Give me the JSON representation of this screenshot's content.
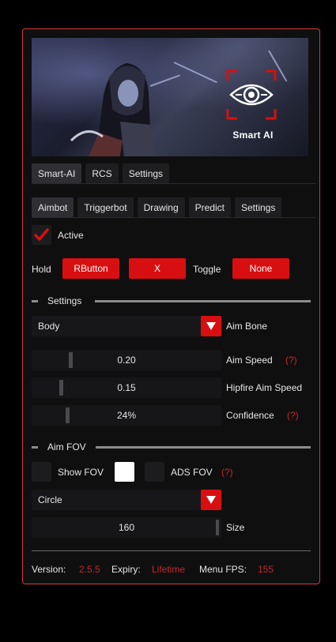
{
  "banner": {
    "title": "Smart AI"
  },
  "main_tabs": [
    {
      "label": "Smart-AI",
      "active": true
    },
    {
      "label": "RCS",
      "active": false
    },
    {
      "label": "Settings",
      "active": false
    }
  ],
  "sub_tabs": [
    {
      "label": "Aimbot",
      "active": true
    },
    {
      "label": "Triggerbot",
      "active": false
    },
    {
      "label": "Drawing",
      "active": false
    },
    {
      "label": "Predict",
      "active": false
    },
    {
      "label": "Settings",
      "active": false
    }
  ],
  "active": {
    "label": "Active",
    "checked": true
  },
  "hotkeys": {
    "hold_label": "Hold",
    "hold_key1": "RButton",
    "hold_key2": "X",
    "toggle_label": "Toggle",
    "toggle_key": "None"
  },
  "settings_section": {
    "title": "Settings",
    "aim_bone": {
      "value": "Body",
      "label": "Aim Bone"
    },
    "aim_speed": {
      "value": "0.20",
      "label": "Aim Speed",
      "help": "(?)",
      "level": 0.2
    },
    "hipfire_speed": {
      "value": "0.15",
      "label": "Hipfire Aim Speed",
      "level": 0.15
    },
    "confidence": {
      "value": "24%",
      "label": "Confidence",
      "help": "(?)",
      "level": 0.24
    }
  },
  "fov_section": {
    "title": "Aim FOV",
    "show_fov_label": "Show FOV",
    "show_fov_checked": false,
    "ads_fov_label": "ADS FOV",
    "ads_fov_checked": false,
    "ads_help": "(?)",
    "fov_color": "#ffffff",
    "shape": "Circle",
    "size": {
      "value": "160",
      "label": "Size",
      "level": 1.0
    }
  },
  "footer": {
    "version_label": "Version:",
    "version": "2.5.5",
    "expiry_label": "Expiry:",
    "expiry": "Lifetime",
    "fps_label": "Menu FPS:",
    "fps": "155"
  },
  "colors": {
    "accent": "#d80f10",
    "border": "#d43a3a",
    "help": "#c4272b"
  }
}
